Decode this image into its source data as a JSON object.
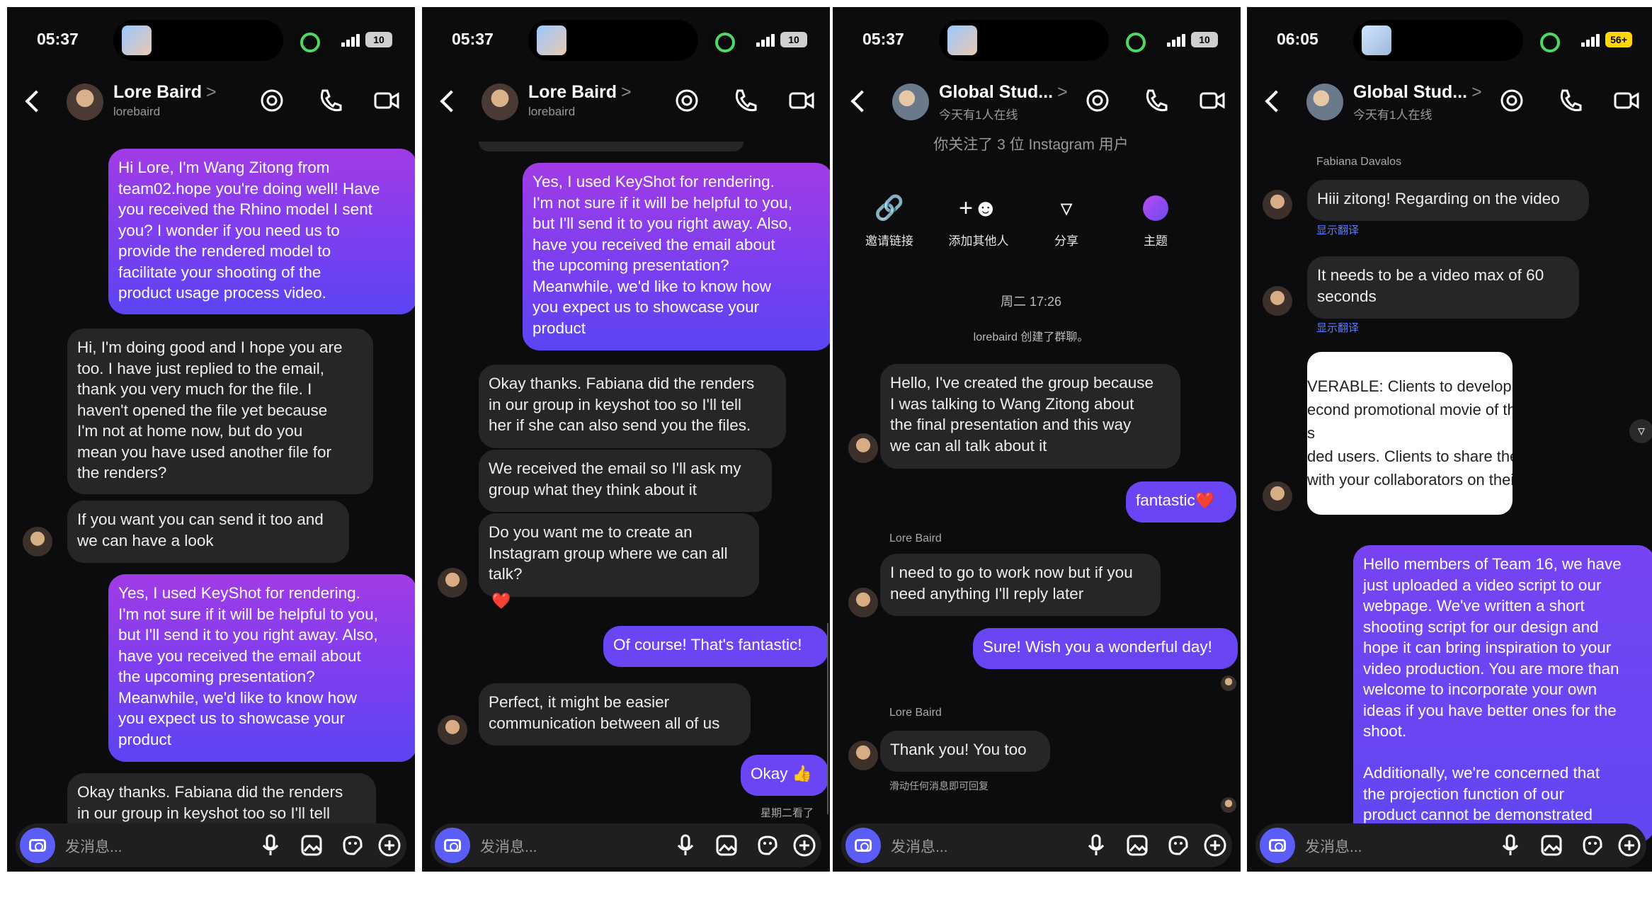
{
  "status": {
    "panel1_time": "05:37",
    "panel2_time": "05:37",
    "panel3_time": "05:37",
    "panel4_time": "06:05",
    "battery_1": "10",
    "battery_2": "10",
    "battery_3": "10",
    "battery_4": "56+"
  },
  "composer": {
    "placeholder": "发消息..."
  },
  "panel1": {
    "header": {
      "name": "Lore Baird",
      "username": "lorebaird"
    },
    "messages": [
      {
        "dir": "out",
        "text": "Hi Lore, I'm Wang Zitong from\nteam02.hope you're doing well! Have\nyou received the Rhino model I sent\nyou? I wonder if you need us to\nprovide the rendered model to\nfacilitate your shooting of the\nproduct usage process video."
      },
      {
        "dir": "in",
        "text": "Hi, I'm doing good and I hope you are\ntoo. I have just replied to the email,\nthank you very much for the file. I\nhaven't opened the file yet because\nI'm not at home now, but do you\nmean you have used another file for\nthe renders?"
      },
      {
        "dir": "in",
        "text": "If you want you can send it too and\nwe can have a look"
      },
      {
        "dir": "out",
        "text": "Yes, I used KeyShot for rendering.\nI'm not sure if it will be helpful to you,\nbut I'll send it to you right away. Also,\nhave you received the email about\nthe upcoming presentation?\nMeanwhile, we'd like to know how\nyou expect us to showcase your\nproduct"
      },
      {
        "dir": "in",
        "text": "Okay thanks. Fabiana did the renders\nin our group in keyshot too so I'll tell"
      }
    ]
  },
  "panel2": {
    "header": {
      "name": "Lore Baird",
      "username": "lorebaird"
    },
    "messages": [
      {
        "dir": "out",
        "text": "Yes, I used KeyShot for rendering.\nI'm not sure if it will be helpful to you,\nbut I'll send it to you right away. Also,\nhave you received the email about\nthe upcoming presentation?\nMeanwhile, we'd like to know how\nyou expect us to showcase your\nproduct"
      },
      {
        "dir": "in",
        "text": "Okay thanks. Fabiana did the renders\nin our group in keyshot too so I'll tell\nher if she can also send you the files."
      },
      {
        "dir": "in",
        "text": "We received the email so I'll ask my\ngroup what they think about it"
      },
      {
        "dir": "in",
        "text": "Do you want me to create an\nInstagram group where we can all\ntalk?"
      },
      {
        "dir": "out",
        "text": "Of course! That's fantastic!"
      },
      {
        "dir": "in",
        "text": "Perfect, it might be easier\ncommunication between all of us"
      },
      {
        "dir": "out",
        "text": "Okay 👍"
      }
    ],
    "reaction": "❤️",
    "seen": "星期二看了"
  },
  "panel3": {
    "header": {
      "name": "Global Stud...",
      "subtitle": "今天有1人在线"
    },
    "top_text": "你关注了 3 位 Instagram 用户",
    "actions": [
      {
        "label": "邀请链接",
        "icon": "link-icon"
      },
      {
        "label": "添加其他人",
        "icon": "add-person-icon"
      },
      {
        "label": "分享",
        "icon": "share-icon"
      },
      {
        "label": "主题",
        "icon": "theme-icon"
      }
    ],
    "timestamp": "周二 17:26",
    "system_msg": "lorebaird 创建了群聊。",
    "messages": [
      {
        "dir": "in",
        "text": "Hello, I've created the group because\nI was talking to Wang Zitong about\nthe final presentation and this way\nwe can all talk about it"
      },
      {
        "dir": "out",
        "text": "fantastic❤️"
      },
      {
        "dir": "in",
        "sender": "Lore Baird",
        "text": "I need to go to work now but if you\nneed anything I'll reply later"
      },
      {
        "dir": "out",
        "text": "Sure! Wish you a wonderful day!"
      },
      {
        "dir": "in",
        "sender": "Lore Baird",
        "text": "Thank you! You too"
      }
    ],
    "swipe_hint": "滑动任何消息即可回复"
  },
  "panel4": {
    "header": {
      "name": "Global Stud...",
      "subtitle": "今天有1人在线"
    },
    "sender": "Fabiana Davalos",
    "messages": [
      {
        "dir": "in",
        "text": "Hiii zitong! Regarding on the video"
      },
      {
        "dir": "in",
        "text": "It needs to be a video max of 60\nseconds"
      },
      {
        "dir": "out",
        "text": "Hello members of Team 16, we have\njust uploaded a video script to our\nwebpage. We've written a short\nshooting script for our design and\nhope it can bring inspiration to your\nvideo production. You are more than\nwelcome to incorporate your own\nideas if you have better ones for the\nshoot.\n\nAdditionally, we're concerned that\nthe projection function of our\nproduct cannot be demonstrated"
      }
    ],
    "translate": "显示翻译",
    "card_lines": [
      "VERABLE: Clients to develop a maximu",
      "econd promotional movie of the product u",
      "s",
      "ded users. Clients to share the promotio",
      "with your collaborators on their project"
    ]
  }
}
